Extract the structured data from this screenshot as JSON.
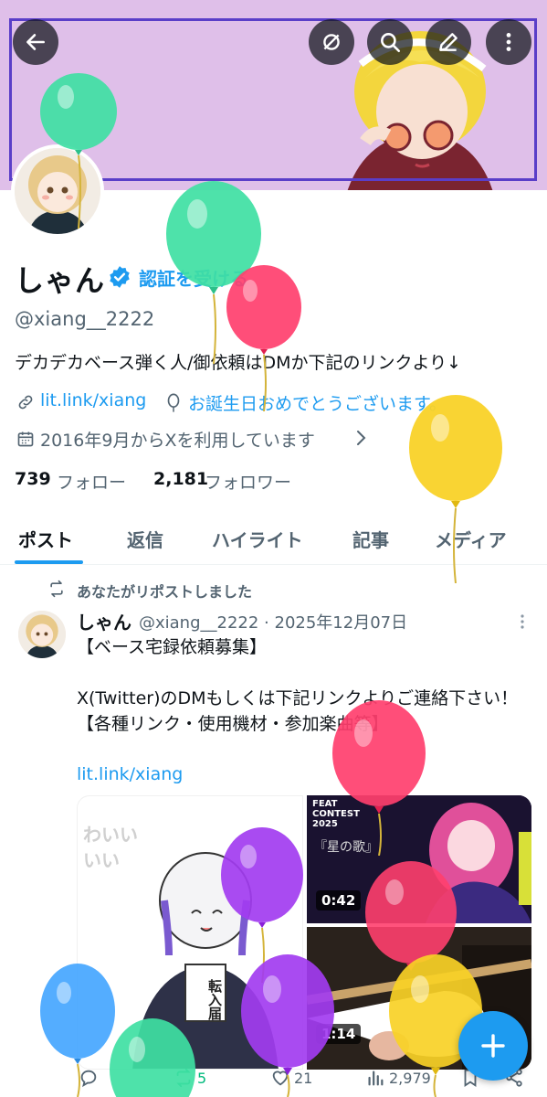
{
  "colors": {
    "accent": "#1d9bf0",
    "banner_bg": "#dfbfe9",
    "text_primary": "#0f1419",
    "text_secondary": "#536471"
  },
  "profile": {
    "display_name": "しゃん",
    "verify_cta": "認証を受ける",
    "handle": "@xiang__2222",
    "bio": "デカデカベース弾く人/御依頼はDMか下記のリンクより↓",
    "link": "lit.link/xiang",
    "birthday_message": "お誕生日おめでとうございます。",
    "joined": "2016年9月からXを利用しています",
    "following_count": "739",
    "following_label": "フォロー",
    "followers_count": "2,181",
    "followers_label": "フォロワー"
  },
  "tabs": [
    {
      "label": "ポスト",
      "active": true
    },
    {
      "label": "返信"
    },
    {
      "label": "ハイライト"
    },
    {
      "label": "記事"
    },
    {
      "label": "メディア"
    }
  ],
  "post": {
    "repost_notice": "あなたがリポストしました",
    "author": "しゃん",
    "meta": "@xiang__2222 · 2025年12月07日",
    "body": "【ベース宅録依頼募集】\n\nX(Twitter)のDMもしくは下記リンクよりご連絡下さい！\n【各種リンク・使用機材・参加楽曲等】",
    "link": "lit.link/xiang",
    "media": [
      {
        "duration": "0:42",
        "caption": "『星の歌』",
        "badge": "FEAT CONTEST 2025"
      },
      {
        "duration": "1:14"
      }
    ],
    "media_left_text": [
      "わいい",
      "いい",
      "転入届"
    ],
    "actions": {
      "reposts": "5",
      "likes": "21",
      "views": "2,979"
    }
  },
  "icons": [
    "back-arrow-icon",
    "hide-replies-icon",
    "search-icon",
    "edit-icon",
    "more-vertical-icon",
    "verified-badge-icon",
    "link-icon",
    "birthday-balloon-icon",
    "calendar-icon",
    "chevron-right-icon",
    "repost-icon",
    "reply-icon",
    "like-icon",
    "views-icon",
    "bookmark-icon",
    "share-icon",
    "compose-plus-icon"
  ]
}
